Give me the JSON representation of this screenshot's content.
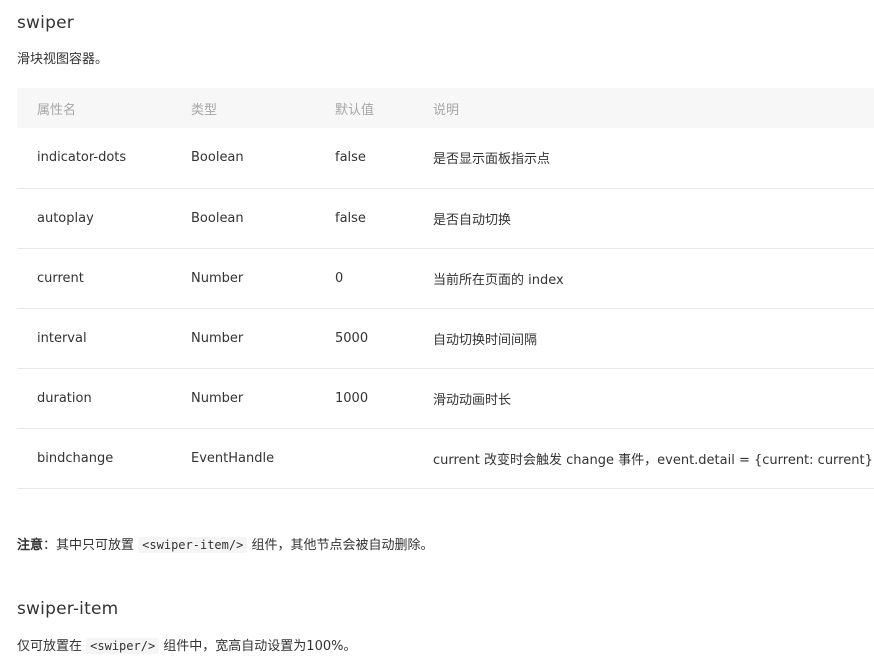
{
  "swiper": {
    "title": "swiper",
    "description": "滑块视图容器。"
  },
  "table": {
    "headers": [
      "属性名",
      "类型",
      "默认值",
      "说明"
    ],
    "rows": [
      {
        "name": "indicator-dots",
        "type": "Boolean",
        "default": "false",
        "desc": "是否显示面板指示点"
      },
      {
        "name": "autoplay",
        "type": "Boolean",
        "default": "false",
        "desc": "是否自动切换"
      },
      {
        "name": "current",
        "type": "Number",
        "default": "0",
        "desc": "当前所在页面的 index"
      },
      {
        "name": "interval",
        "type": "Number",
        "default": "5000",
        "desc": "自动切换时间间隔"
      },
      {
        "name": "duration",
        "type": "Number",
        "default": "1000",
        "desc": "滑动动画时长"
      },
      {
        "name": "bindchange",
        "type": "EventHandle",
        "default": "",
        "desc": "current 改变时会触发 change 事件，event.detail = {current: current}"
      }
    ]
  },
  "note": {
    "label": "注意",
    "colon": "：",
    "before": "其中只可放置 ",
    "code": "<swiper-item/>",
    "after": " 组件，其他节点会被自动删除。"
  },
  "swiper_item": {
    "title": "swiper-item",
    "before": "仅可放置在 ",
    "code": "<swiper/>",
    "after": " 组件中，宽高自动设置为100%。"
  }
}
